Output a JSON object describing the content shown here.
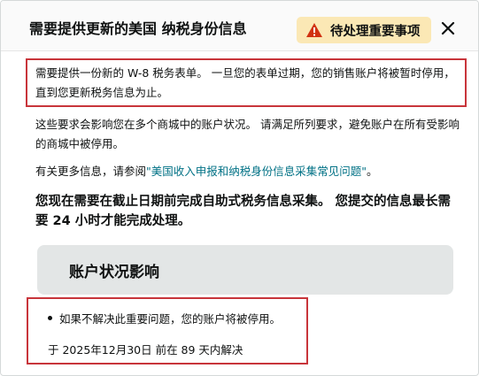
{
  "header": {
    "title": "需要提供更新的美国 纳税身份信息",
    "badge_label": "待处理重要事项",
    "badge_icon": "warning-icon",
    "close_icon": "close-icon"
  },
  "body": {
    "notice": "需要提供一份新的 W-8 税务表单。 一旦您的表单过期，您的销售账户将被暂时停用，直到您更新税务信息为止。",
    "impact_scope": "这些要求会影响您在多个商城中的账户状况。 请满足所列要求，避免账户在所有受影响的商城中被停用。",
    "more_info_prefix": "有关更多信息，请参阅",
    "more_info_link": "\"美国收入申报和纳税身份信息采集常见问题\"",
    "more_info_suffix": "。",
    "action_required": "您现在需要在截止日期前完成自助式税务信息采集。 您提交的信息最长需要 24 小时才能完成处理。"
  },
  "impact": {
    "title": "账户状况影响",
    "bullet": "如果不解决此重要问题，您的账户将被停用。",
    "deadline": "于 2025年12月30日 前在 89 天内解决"
  },
  "colors": {
    "highlight_border": "#c8353b",
    "badge_bg": "#fbe8b5",
    "warning_icon": "#d13212",
    "link": "#007185",
    "impact_bg": "#e3e6e6"
  }
}
